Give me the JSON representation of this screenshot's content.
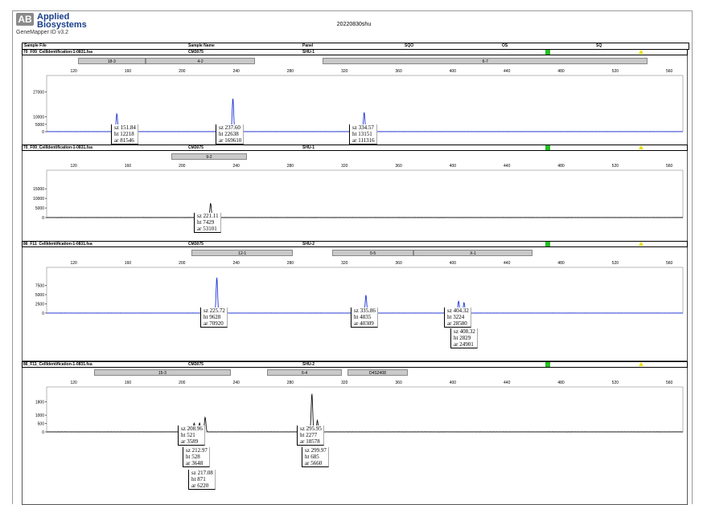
{
  "header": {
    "brand_line1": "Applied",
    "brand_line2": "Biosystems",
    "software": "GeneMapper ID v3.2",
    "run_title": "20220830shu",
    "columns": [
      "Sample File",
      "Sample Name",
      "Panel",
      "SQO",
      "OS",
      "SQ"
    ]
  },
  "chart_data": [
    {
      "type": "line",
      "sample_file": "70_F09_CellIdentification-1-0831.fsa",
      "sample_name": "CM3075",
      "panel": "SHU-1",
      "x_ticks": [
        120,
        160,
        200,
        240,
        280,
        320,
        360,
        400,
        440,
        480,
        520,
        560
      ],
      "xlim": [
        100,
        570
      ],
      "ylim": [
        0,
        30000
      ],
      "y_ticks": [
        0,
        5000,
        10000,
        27000
      ],
      "y_tick_labels": [
        "0",
        "5000",
        "10000",
        "27000"
      ],
      "color": "#1f35d6",
      "bins": [
        {
          "label": "18-3",
          "from": 123,
          "to": 173
        },
        {
          "label": "4-2",
          "from": 173,
          "to": 254
        },
        {
          "label": "6-7",
          "from": 304,
          "to": 544
        }
      ],
      "peaks": [
        {
          "size": 151.84,
          "height": 12218,
          "area": 81546
        },
        {
          "size": 237.6,
          "height": 22638,
          "area": 169610
        },
        {
          "size": 334.57,
          "height": 13151,
          "area": 111316
        }
      ]
    },
    {
      "type": "line",
      "sample_file": "70_F09_CellIdentification-1-0831.fsa",
      "sample_name": "CM3075",
      "panel": "SHU-1",
      "x_ticks": [
        120,
        160,
        200,
        240,
        280,
        320,
        360,
        400,
        440,
        480,
        520,
        560
      ],
      "xlim": [
        100,
        570
      ],
      "ylim": [
        0,
        18000
      ],
      "y_ticks": [
        0,
        5000,
        10000,
        15000
      ],
      "y_tick_labels": [
        "0",
        "5000",
        "10000",
        "15000"
      ],
      "color": "#111111",
      "bins": [
        {
          "label": "9-2",
          "from": 192,
          "to": 248
        }
      ],
      "peaks": [
        {
          "size": 221.11,
          "height": 7429,
          "area": 53101
        }
      ]
    },
    {
      "type": "line",
      "sample_file": "86_F11_CellIdentification-1-0831.fsa",
      "sample_name": "CM3075",
      "panel": "SHU-2",
      "x_ticks": [
        120,
        160,
        200,
        240,
        280,
        320,
        360,
        400,
        440,
        480,
        520,
        560
      ],
      "xlim": [
        100,
        570
      ],
      "ylim": [
        0,
        10000
      ],
      "y_ticks": [
        0,
        2500,
        5000,
        7500
      ],
      "y_tick_labels": [
        "0",
        "2500",
        "5000",
        "7500"
      ],
      "color": "#1f35d6",
      "bins": [
        {
          "label": "12-1",
          "from": 207,
          "to": 282
        },
        {
          "label": "5-5",
          "from": 311,
          "to": 371
        },
        {
          "label": "X-1",
          "from": 371,
          "to": 459
        }
      ],
      "peaks": [
        {
          "size": 225.72,
          "height": 9628,
          "area": 70920
        },
        {
          "size": 335.86,
          "height": 4835,
          "area": 40309
        },
        {
          "size": 404.32,
          "height": 3224,
          "area": 28580
        },
        {
          "size": 408.32,
          "height": 2829,
          "area": 24901
        }
      ]
    },
    {
      "type": "line",
      "sample_file": "86_F11_CellIdentification-1-0831.fsa",
      "sample_name": "CM3075",
      "panel": "SHU-2",
      "x_ticks": [
        120,
        160,
        200,
        240,
        280,
        320,
        360,
        400,
        440,
        480,
        520,
        560
      ],
      "xlim": [
        100,
        570
      ],
      "ylim": [
        0,
        2200
      ],
      "y_ticks": [
        0,
        500,
        1000,
        1800
      ],
      "y_tick_labels": [
        "0",
        "500",
        "1000",
        "1800"
      ],
      "color": "#111111",
      "bins": [
        {
          "label": "15-3",
          "from": 135,
          "to": 236
        },
        {
          "label": "6-4",
          "from": 263,
          "to": 318
        },
        {
          "label": "D4S2408",
          "from": 322,
          "to": 367
        }
      ],
      "peaks": [
        {
          "size": 208.96,
          "height": 521,
          "area": 3589
        },
        {
          "size": 212.97,
          "height": 528,
          "area": 3648
        },
        {
          "size": 217.08,
          "height": 871,
          "area": 6220
        },
        {
          "size": 295.95,
          "height": 2277,
          "area": 18578
        },
        {
          "size": 299.97,
          "height": 685,
          "area": 5660
        }
      ]
    }
  ]
}
